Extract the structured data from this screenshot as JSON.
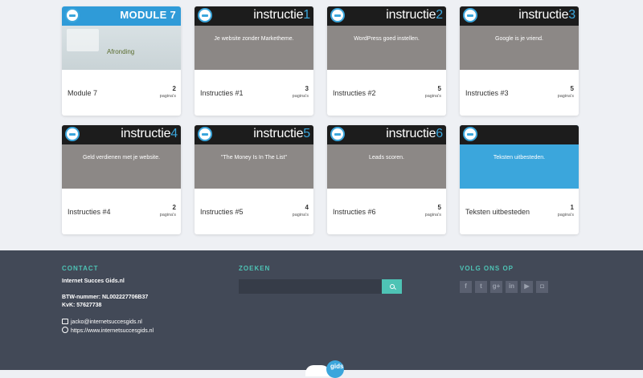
{
  "cards": [
    {
      "type": "module",
      "module_title": "MODULE 7",
      "subtitle": "Afronding",
      "title": "Module 7",
      "count": "2",
      "unit": "pagina's"
    },
    {
      "type": "instruct",
      "brand": "instructie",
      "num": "1",
      "tagline": "Je website zonder Marketheme.",
      "title": "Instructies #1",
      "count": "3",
      "unit": "pagina's"
    },
    {
      "type": "instruct",
      "brand": "instructie",
      "num": "2",
      "tagline": "WordPress goed instellen.",
      "title": "Instructies #2",
      "count": "5",
      "unit": "pagina's"
    },
    {
      "type": "instruct",
      "brand": "instructie",
      "num": "3",
      "tagline": "Google is je vriend.",
      "title": "Instructies #3",
      "count": "5",
      "unit": "pagina's"
    },
    {
      "type": "instruct",
      "brand": "instructie",
      "num": "4",
      "tagline": "Geld verdienen met je website.",
      "title": "Instructies #4",
      "count": "2",
      "unit": "pagina's"
    },
    {
      "type": "instruct",
      "brand": "instructie",
      "num": "5",
      "tagline": "\"The Money Is In The List\"",
      "title": "Instructies #5",
      "count": "4",
      "unit": "pagina's"
    },
    {
      "type": "instruct",
      "brand": "instructie",
      "num": "6",
      "tagline": "Leads scoren.",
      "title": "Instructies #6",
      "count": "5",
      "unit": "pagina's"
    },
    {
      "type": "blue",
      "tagline": "Teksten uitbesteden.",
      "title": "Teksten uitbesteden",
      "count": "1",
      "unit": "pagina's"
    }
  ],
  "footer": {
    "contact_heading": "CONTACT",
    "company": "Internet Succes Gids.nl",
    "btw": "BTW-nummer: NL002227706B37",
    "kvk": "KvK: 57627738",
    "email": "jacko@internetsuccesgids.nl",
    "website": "https://www.internetsuccesgids.nl",
    "search_heading": "ZOEKEN",
    "search_value": "",
    "social_heading": "VOLG ONS OP",
    "social": [
      {
        "name": "facebook-icon",
        "glyph": "f"
      },
      {
        "name": "twitter-icon",
        "glyph": "t"
      },
      {
        "name": "google-plus-icon",
        "glyph": "g+"
      },
      {
        "name": "linkedin-icon",
        "glyph": "in"
      },
      {
        "name": "youtube-icon",
        "glyph": "▶"
      },
      {
        "name": "instagram-icon",
        "glyph": "◘"
      }
    ],
    "logo_text": "gids"
  },
  "colors": {
    "accent": "#3ba6dc",
    "teal": "#4ec3b5",
    "footer_bg": "#424957",
    "page_bg": "#eef0f4"
  }
}
